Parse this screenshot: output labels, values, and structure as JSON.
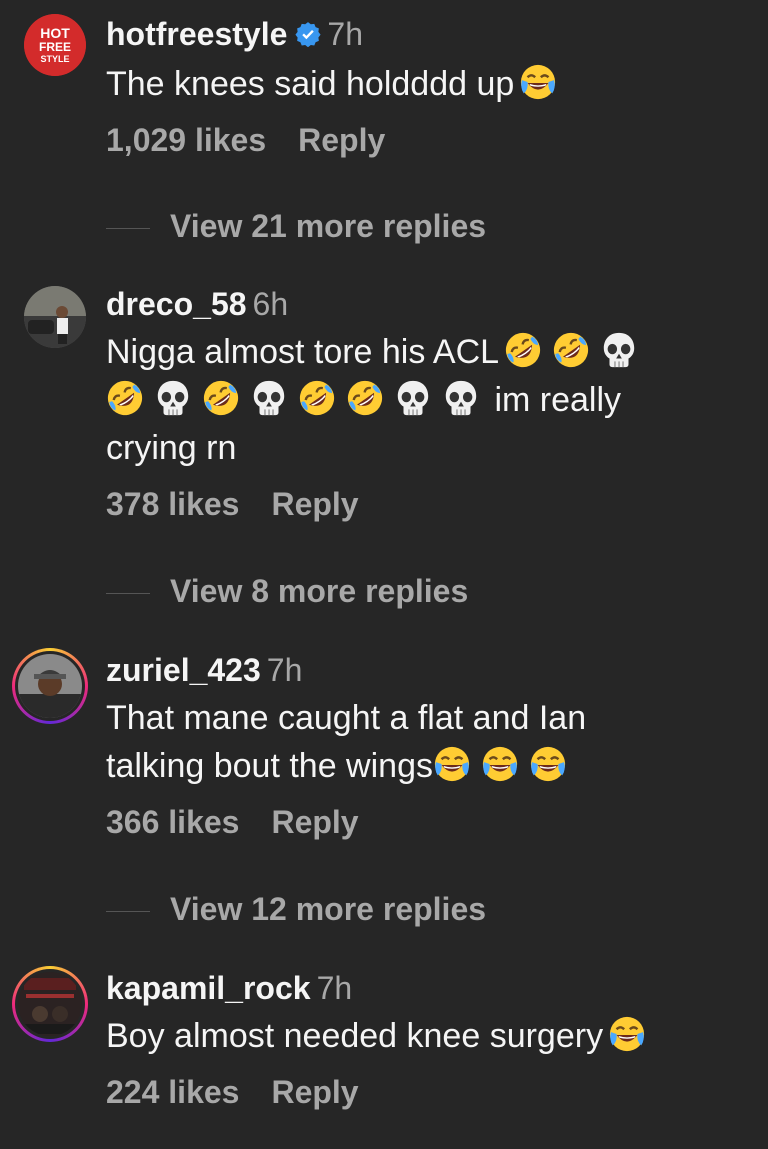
{
  "comments": [
    {
      "username": "hotfreestyle",
      "verified": true,
      "time": "7h",
      "text_parts": [
        "The knees said holdddd up"
      ],
      "likes": "1,029 likes",
      "reply": "Reply",
      "view_replies": "View 21 more replies",
      "avatar": {
        "lines": [
          "HOT",
          "FREE",
          "STYLE"
        ],
        "color": "#d32b2b"
      }
    },
    {
      "username": "dreco_58",
      "verified": false,
      "time": "6h",
      "text_parts": [
        "Nigga almost tore his ACL",
        "im really",
        "crying rn"
      ],
      "likes": "378 likes",
      "reply": "Reply",
      "view_replies": "View 8 more replies"
    },
    {
      "username": "zuriel_423",
      "verified": false,
      "time": "7h",
      "text_parts": [
        "That mane caught a flat and Ian",
        "talking bout the wings"
      ],
      "likes": "366 likes",
      "reply": "Reply",
      "view_replies": "View 12 more replies"
    },
    {
      "username": "kapamil_rock",
      "verified": false,
      "time": "7h",
      "text_parts": [
        "Boy almost needed knee surgery"
      ],
      "likes": "224 likes",
      "reply": "Reply"
    }
  ],
  "colors": {
    "background": "#262626",
    "primary_text": "#f5f5f5",
    "secondary_text": "#a8a8a8",
    "verified_badge": "#3897f0"
  },
  "icons": [
    "verified-badge-icon",
    "tears-of-joy-emoji",
    "rofl-emoji",
    "skull-emoji"
  ]
}
